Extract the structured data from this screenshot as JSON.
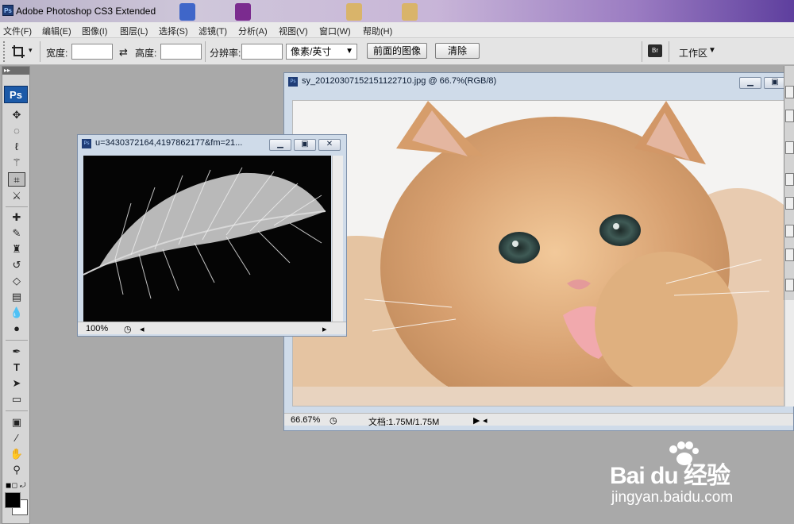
{
  "app": {
    "title": "Adobe Photoshop CS3 Extended",
    "icon_label": "Ps"
  },
  "menu": [
    "文件(F)",
    "编辑(E)",
    "图像(I)",
    "图层(L)",
    "选择(S)",
    "滤镜(T)",
    "分析(A)",
    "视图(V)",
    "窗口(W)",
    "帮助(H)"
  ],
  "options": {
    "width_label": "宽度:",
    "height_label": "高度:",
    "resolution_label": "分辨率:",
    "unit_select": "像素/英寸",
    "front_image_button": "前面的图像",
    "clear_button": "清除",
    "workspace_label": "工作区"
  },
  "toolbox": {
    "logo": "Ps"
  },
  "doc_cat": {
    "title": "sy_20120307152151122710.jpg @ 66.7%(RGB/8)",
    "zoom": "66.67%",
    "doc_size": "文档:1.75M/1.75M"
  },
  "doc_feather": {
    "title": "u=3430372164,4197862177&fm=21...",
    "zoom": "100%"
  },
  "watermark": {
    "brand": "Bai du 经验",
    "url": "jingyan.baidu.com"
  },
  "colors": {
    "photoshop_blue": "#1c5aa8",
    "doc_frame": "#cfdbe9",
    "workspace_gray": "#a9a9a9"
  },
  "icons": [
    "crop-icon",
    "swap-icon",
    "move-icon",
    "lasso-icon",
    "brush-icon",
    "eraser-icon",
    "pen-icon",
    "type-icon",
    "hand-icon",
    "zoom-icon"
  ]
}
